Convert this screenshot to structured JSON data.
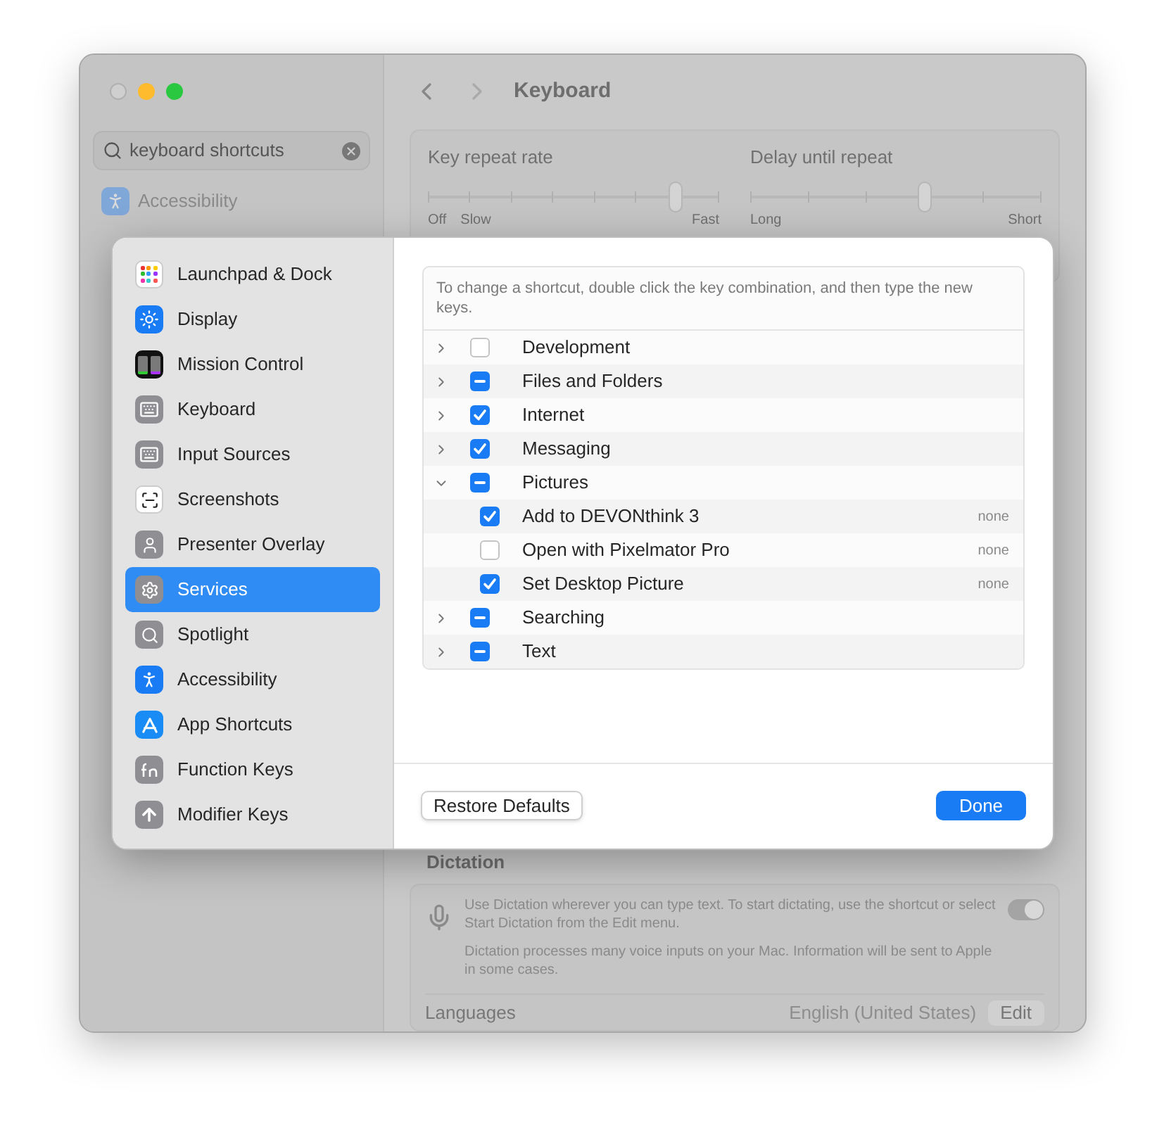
{
  "window": {
    "title": "Keyboard",
    "search": {
      "value": "keyboard shortcuts"
    },
    "sidebar": {
      "items": [
        {
          "label": "Accessibility",
          "kind": "accessibility"
        }
      ]
    },
    "key_repeat": {
      "title": "Key repeat rate",
      "level": 0.85,
      "labels": [
        "Off",
        "Slow",
        "Fast"
      ]
    },
    "delay": {
      "title": "Delay until repeat",
      "level": 0.6,
      "labels": [
        "Long",
        "Short"
      ]
    },
    "dictation": {
      "title": "Dictation",
      "description": "Use Dictation wherever you can type text. To start dictating, use the shortcut or select Start Dictation from the Edit menu.",
      "on": true,
      "note": "Dictation processes many voice inputs on your Mac. Information will be sent to Apple in some cases.",
      "languages_label": "Languages",
      "languages_value": "English (United States)",
      "edit_button": "Edit"
    }
  },
  "sheet": {
    "sidebar": [
      {
        "label": "Launchpad & Dock",
        "kind": "launchpad",
        "selected": false
      },
      {
        "label": "Display",
        "kind": "display",
        "selected": false
      },
      {
        "label": "Mission Control",
        "kind": "mission",
        "selected": false
      },
      {
        "label": "Keyboard",
        "kind": "keyboard",
        "selected": false
      },
      {
        "label": "Input Sources",
        "kind": "keyboard",
        "selected": false
      },
      {
        "label": "Screenshots",
        "kind": "screenshot",
        "selected": false
      },
      {
        "label": "Presenter Overlay",
        "kind": "presenter",
        "selected": false
      },
      {
        "label": "Services",
        "kind": "services",
        "selected": true
      },
      {
        "label": "Spotlight",
        "kind": "spotlight",
        "selected": false
      },
      {
        "label": "Accessibility",
        "kind": "accessibility",
        "selected": false
      },
      {
        "label": "App Shortcuts",
        "kind": "appstore",
        "selected": false
      },
      {
        "label": "Function Keys",
        "kind": "fn",
        "selected": false
      },
      {
        "label": "Modifier Keys",
        "kind": "modifier",
        "selected": false
      }
    ],
    "hint": "To change a shortcut, double click the key combination, and then type the new keys.",
    "rows": [
      {
        "label": "Development",
        "checked": false,
        "expanded": false
      },
      {
        "label": "Files and Folders",
        "checked": true,
        "partial": true,
        "expanded": false
      },
      {
        "label": "Internet",
        "checked": true,
        "partial": false,
        "expanded": false
      },
      {
        "label": "Messaging",
        "checked": true,
        "partial": false,
        "expanded": false
      },
      {
        "label": "Pictures",
        "checked": true,
        "partial": true,
        "expanded": true,
        "children": [
          {
            "label": "Add to DEVONthink 3",
            "checked": true,
            "shortcut": "none"
          },
          {
            "label": "Open with Pixelmator Pro",
            "checked": false,
            "shortcut": "none"
          },
          {
            "label": "Set Desktop Picture",
            "checked": true,
            "shortcut": "none"
          }
        ]
      },
      {
        "label": "Searching",
        "checked": true,
        "partial": true,
        "expanded": false
      },
      {
        "label": "Text",
        "checked": true,
        "partial": true,
        "expanded": false
      }
    ],
    "restore_button": "Restore Defaults",
    "done_button": "Done"
  }
}
